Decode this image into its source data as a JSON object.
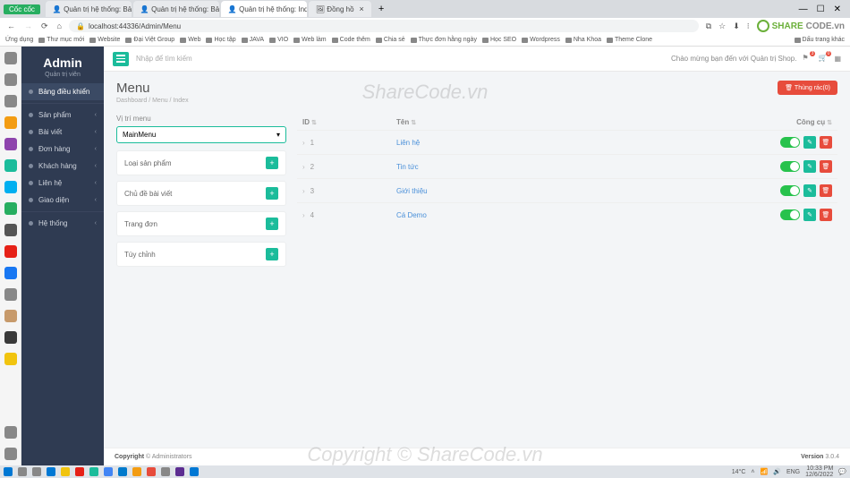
{
  "browser": {
    "tabs": [
      {
        "label": "Cốc cốc"
      },
      {
        "label": "Quản trị hệ thống: Bảng điề..."
      },
      {
        "label": "Quản trị hệ thống: Bảng điề..."
      },
      {
        "label": "Quản trị hệ thống: Index"
      },
      {
        "label": "Đồng hồ"
      }
    ],
    "url": "localhost:44336/Admin/Menu",
    "bookmarks": [
      "Ứng dụng",
      "Thư mục mới",
      "Website",
      "Đại Việt Group",
      "Web",
      "Học tập",
      "JAVA",
      "VIO",
      "Web làm",
      "Code thêm",
      "Chia sẻ",
      "Thực đơn hằng ngày",
      "Học SEO",
      "Wordpress",
      "Nha Khoa",
      "Theme Clone"
    ],
    "bookmarks_right_label": "Dấu trang khác",
    "sharecode": {
      "green": "SHARE",
      "grey": "CODE.vn"
    }
  },
  "sidebar": {
    "title": "Admin",
    "subtitle": "Quản trị viên",
    "items": [
      {
        "label": "Bảng điều khiển",
        "active": true,
        "expandable": false
      },
      {
        "label": "Sản phẩm",
        "expandable": true
      },
      {
        "label": "Bài viết",
        "expandable": true
      },
      {
        "label": "Đơn hàng",
        "expandable": true
      },
      {
        "label": "Khách hàng",
        "expandable": true
      },
      {
        "label": "Liên hệ",
        "expandable": true
      },
      {
        "label": "Giao diện",
        "expandable": true
      },
      {
        "label": "Hệ thống",
        "expandable": true
      }
    ]
  },
  "topbar": {
    "search_placeholder": "Nhập để tìm kiếm",
    "welcome": "Chào mừng bạn đến với Quản trị Shop.",
    "notif_count": "3",
    "cart_count": "0"
  },
  "page": {
    "title": "Menu",
    "breadcrumb": [
      "Dashboard",
      "Menu",
      "Index"
    ],
    "trash_btn": "Thùng rác(0)"
  },
  "menu_panel": {
    "position_label": "Vị trí menu",
    "select_value": "MainMenu",
    "acc_items": [
      "Loại sản phẩm",
      "Chủ đề bài viết",
      "Trang đơn",
      "Tùy chỉnh"
    ]
  },
  "table": {
    "cols": {
      "id": "ID",
      "name": "Tên",
      "tool": "Công cụ"
    },
    "rows": [
      {
        "id": "1",
        "name": "Liên hệ"
      },
      {
        "id": "2",
        "name": "Tin tức"
      },
      {
        "id": "3",
        "name": "Giới thiệu"
      },
      {
        "id": "4",
        "name": "Cá Demo"
      }
    ]
  },
  "footer": {
    "copyright_label": "Copyright",
    "copyright_by": "© Administrators",
    "version_label": "Version",
    "version": "3.0.4"
  },
  "watermark": "ShareCode.vn",
  "watermark2": "Copyright © ShareCode.vn",
  "taskbar": {
    "time": "10:33 PM",
    "date": "12/6/2022",
    "lang": "ENG",
    "weather": "14°C"
  }
}
